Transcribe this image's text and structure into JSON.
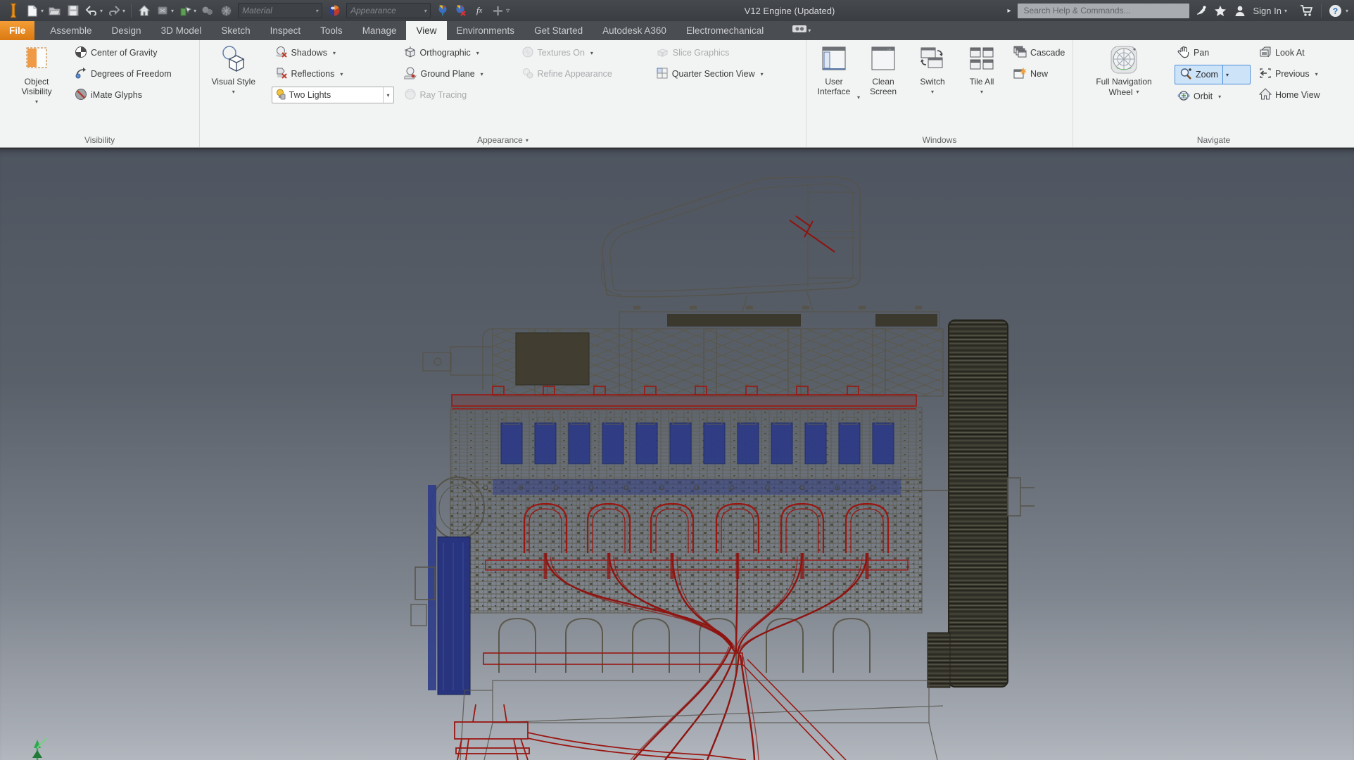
{
  "titlebar": {
    "title": "V12 Engine (Updated)",
    "material_value": "Material",
    "appearance_value": "Appearance",
    "search_placeholder": "Search Help & Commands...",
    "sign_in_label": "Sign In"
  },
  "tabs": [
    {
      "label": "File"
    },
    {
      "label": "Assemble"
    },
    {
      "label": "Design"
    },
    {
      "label": "3D Model"
    },
    {
      "label": "Sketch"
    },
    {
      "label": "Inspect"
    },
    {
      "label": "Tools"
    },
    {
      "label": "Manage"
    },
    {
      "label": "View"
    },
    {
      "label": "Environments"
    },
    {
      "label": "Get Started"
    },
    {
      "label": "Autodesk A360"
    },
    {
      "label": "Electromechanical"
    }
  ],
  "ribbon": {
    "visibility": {
      "panel_label": "Visibility",
      "object_visibility_1": "Object",
      "object_visibility_2": "Visibility",
      "center_of_gravity": "Center of Gravity",
      "degrees_of_freedom": "Degrees of Freedom",
      "imate_glyphs": "iMate Glyphs"
    },
    "appearance": {
      "panel_label": "Appearance",
      "visual_style": "Visual Style",
      "shadows": "Shadows",
      "reflections": "Reflections",
      "two_lights": "Two Lights",
      "orthographic": "Orthographic",
      "ground_plane": "Ground Plane",
      "ray_tracing": "Ray Tracing",
      "textures_on": "Textures On",
      "refine_appearance": "Refine Appearance",
      "slice_graphics": "Slice Graphics",
      "quarter_section_view": "Quarter Section View"
    },
    "windows": {
      "panel_label": "Windows",
      "user_interface_1": "User",
      "user_interface_2": "Interface",
      "clean_screen_1": "Clean",
      "clean_screen_2": "Screen",
      "switch": "Switch",
      "tile_all": "Tile All",
      "cascade": "Cascade",
      "new": "New"
    },
    "navigate": {
      "panel_label": "Navigate",
      "full_nav_1": "Full Navigation",
      "full_nav_2": "Wheel",
      "pan": "Pan",
      "zoom": "Zoom",
      "orbit": "Orbit",
      "look_at": "Look At",
      "previous": "Previous",
      "home_view": "Home View"
    }
  },
  "colors": {
    "file_tab_orange": "#E8851D",
    "active_tab_bg": "#F2F3F3",
    "zoom_highlight_blue": "#CDE3F8",
    "viewport_gradient_top": "#4E5560",
    "viewport_gradient_bottom": "#A9AEB6",
    "wireframe_gray": "#5C5A4C",
    "wireframe_red": "#8E1410",
    "wireframe_blue": "#2C3A86",
    "triad_green": "#2FA84F"
  }
}
